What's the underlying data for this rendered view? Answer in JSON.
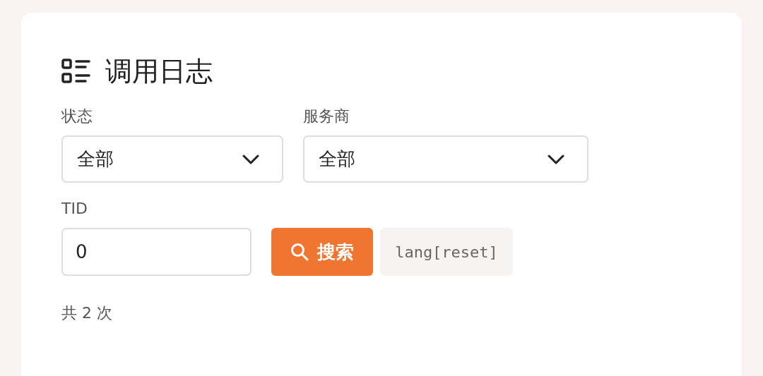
{
  "title": "调用日志",
  "filters": [
    {
      "label": "状态",
      "value": "全部"
    },
    {
      "label": "服务商",
      "value": "全部"
    }
  ],
  "tid": {
    "label": "TID",
    "value": "0"
  },
  "search_button": {
    "label": "搜索"
  },
  "reset_button": {
    "label": "lang[reset]"
  },
  "total": "共 2 次"
}
